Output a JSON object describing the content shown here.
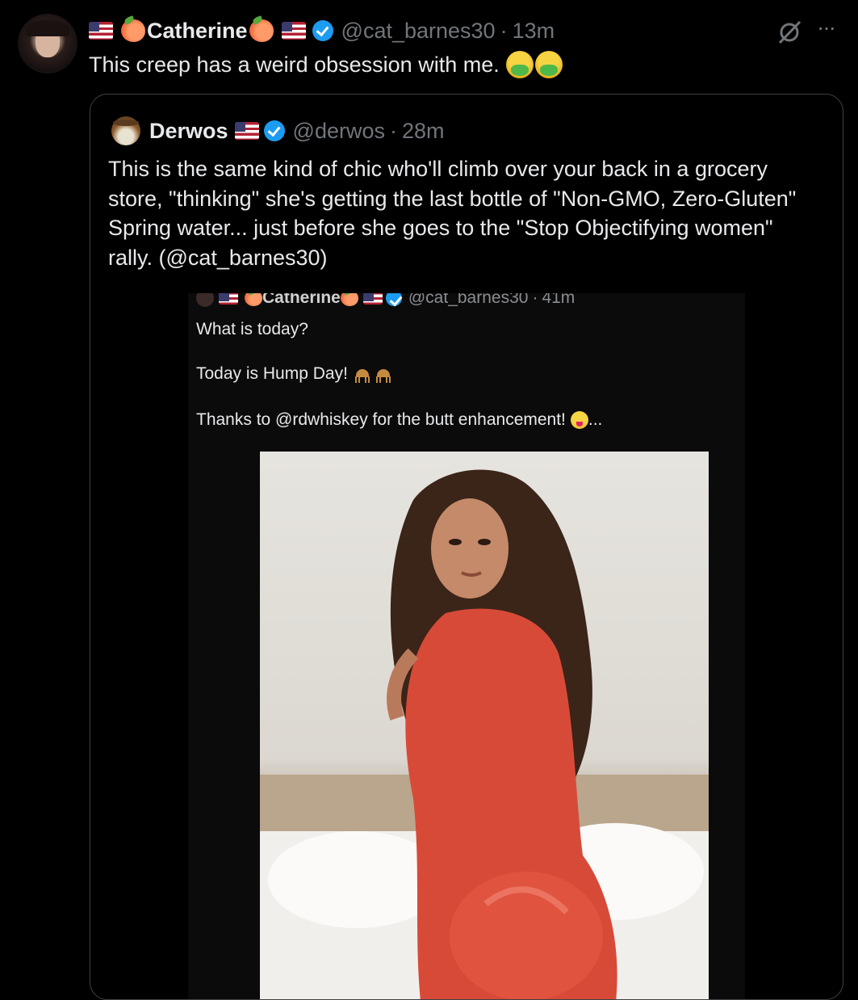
{
  "tweet": {
    "author_name": "Catherine",
    "handle": "@cat_barnes30",
    "time": "13m",
    "text": "This creep has a weird obsession with me."
  },
  "quoted": {
    "author_name": "Derwos",
    "handle": "@derwos",
    "time": "28m",
    "text": "This is the same kind of chic who'll climb over your back in a grocery store, \"thinking\" she's getting the last bottle of \"Non-GMO, Zero-Gluten\" Spring water... just before she goes to the \"Stop Objectifying women\" rally. (@cat_barnes30)"
  },
  "screenshot": {
    "author_name": "Catherine",
    "handle": "@cat_barnes30",
    "time": "41m",
    "line1": "What is today?",
    "line2": "Today is Hump Day!",
    "line3": "Thanks to @rdwhiskey for the butt enhancement!",
    "line3_suffix": "..."
  },
  "separator": "·",
  "more_label": "···",
  "icons": {
    "grok": "grok-icon",
    "more": "more-icon",
    "verified": "verified-badge-icon",
    "flag": "us-flag-icon",
    "peach": "peach-icon"
  },
  "colors": {
    "background": "#000000",
    "text": "#e7e9ea",
    "muted": "#71767b",
    "verified": "#1d9bf0"
  }
}
